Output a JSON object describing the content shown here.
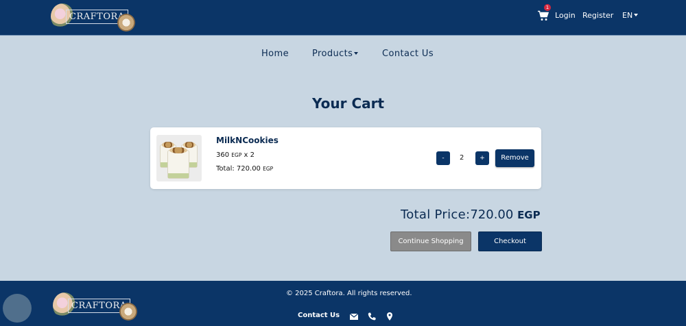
{
  "header": {
    "brand": "CRAFTORA",
    "cart_count": "1",
    "login": "Login",
    "register": "Register",
    "language": "EN"
  },
  "nav": {
    "home": "Home",
    "products": "Products",
    "contact": "Contact Us"
  },
  "page_title": "Your Cart",
  "cart_items": [
    {
      "name": "MilkNCookies",
      "price": "360",
      "currency": "EGP",
      "multiplier": "x 2",
      "total_label": "Total:",
      "total": "720.00",
      "quantity": "2",
      "decrement": "-",
      "increment": "+",
      "remove": "Remove"
    }
  ],
  "summary": {
    "label": "Total Price:",
    "amount": "720.00",
    "currency": "EGP",
    "continue": "Continue Shopping",
    "checkout": "Checkout"
  },
  "footer": {
    "brand": "CRAFTORA",
    "copyright": "© 2025 Craftora. All rights reserved.",
    "contact": "Contact Us",
    "icons": [
      "envelope-icon",
      "phone-icon",
      "location-pin-icon"
    ]
  },
  "colors": {
    "primary": "#0b3567",
    "background": "#c8d6e2",
    "badge": "#d6283f",
    "secondary_button": "#8a8a8a"
  }
}
